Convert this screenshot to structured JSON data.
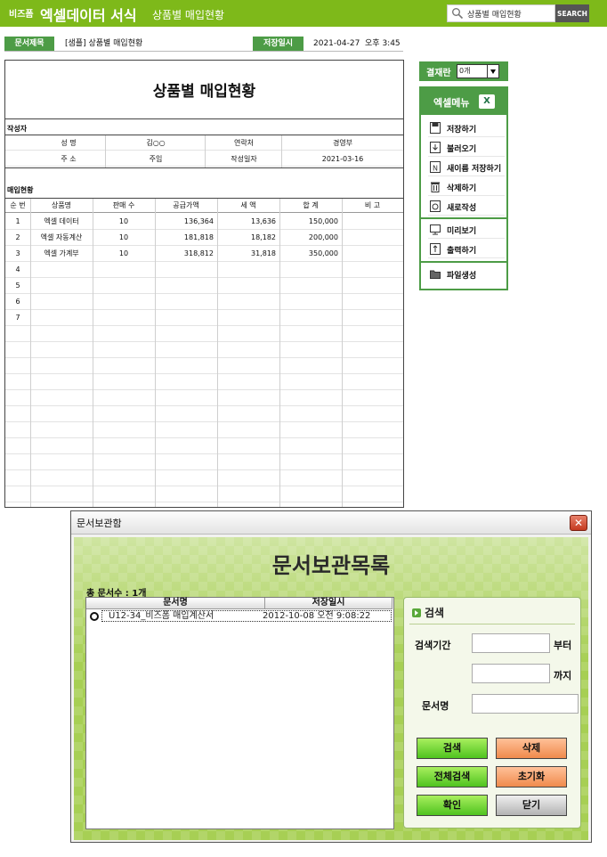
{
  "header": {
    "brand_small": "비즈폼",
    "brand_title": "엑셀데이터 서식",
    "subtitle": "상품별 매입현황",
    "search_value": "상품별 매입현황",
    "search_button": "SEARCH"
  },
  "docinfo": {
    "title_label": "문서제목",
    "title_value": "[샘플] 상품별 매입현황",
    "saved_label": "저장일시",
    "saved_value": "2021-04-27  오후 3:45"
  },
  "sheet": {
    "title": "상품별 매입현황",
    "author_section": "작성자",
    "author_rows": [
      [
        "성 명",
        "김○○",
        "연락처",
        "경영부"
      ],
      [
        "주 소",
        "주임",
        "작성일자",
        "2021-03-16"
      ]
    ],
    "purchase_section": "매입현황",
    "columns": [
      "순 번",
      "상품명",
      "판매 수",
      "공급가액",
      "세 액",
      "합 계",
      "비 고"
    ],
    "rows": [
      [
        "1",
        "엑셀 데이터",
        "10",
        "136,364",
        "13,636",
        "150,000",
        ""
      ],
      [
        "2",
        "엑셀 자동계산",
        "10",
        "181,818",
        "18,182",
        "200,000",
        ""
      ],
      [
        "3",
        "엑셀 가계부",
        "10",
        "318,812",
        "31,818",
        "350,000",
        ""
      ],
      [
        "4",
        "",
        "",
        "",
        "",
        "",
        ""
      ],
      [
        "5",
        "",
        "",
        "",
        "",
        "",
        ""
      ],
      [
        "6",
        "",
        "",
        "",
        "",
        "",
        ""
      ],
      [
        "7",
        "",
        "",
        "",
        "",
        "",
        ""
      ]
    ]
  },
  "side": {
    "approval_label": "결재란",
    "approval_value": "0개",
    "menu_title": "엑셀메뉴",
    "excel_badge": "X",
    "items": [
      "저장하기",
      "불러오기",
      "새이름 저장하기",
      "삭제하기",
      "새로작성"
    ],
    "items2": [
      "미리보기",
      "출력하기"
    ],
    "items3": [
      "파일생성"
    ]
  },
  "dialog": {
    "window_title": "문서보관함",
    "close_glyph": "✕",
    "heading": "문서보관목록",
    "total": "총 문서수 : 1개",
    "col_name": "문서명",
    "col_date": "저장일시",
    "row_name": "U12-34_비즈폼 매입계산서",
    "row_date": "2012-10-08 오전 9:08:22",
    "search_title": "검색",
    "period_label": "검색기간",
    "from_label": "부터",
    "to_label": "까지",
    "docname_label": "문서명",
    "btn_search": "검색",
    "btn_delete": "삭제",
    "btn_search_all": "전체검색",
    "btn_reset": "초기화",
    "btn_ok": "확인",
    "btn_close": "닫기"
  },
  "colors": {
    "brand_green": "#7eb91a",
    "tag_green": "#4d9c46",
    "dialog_green": "#a7cf54",
    "button_green": "#4fc31f",
    "button_orange": "#f08a4c"
  }
}
